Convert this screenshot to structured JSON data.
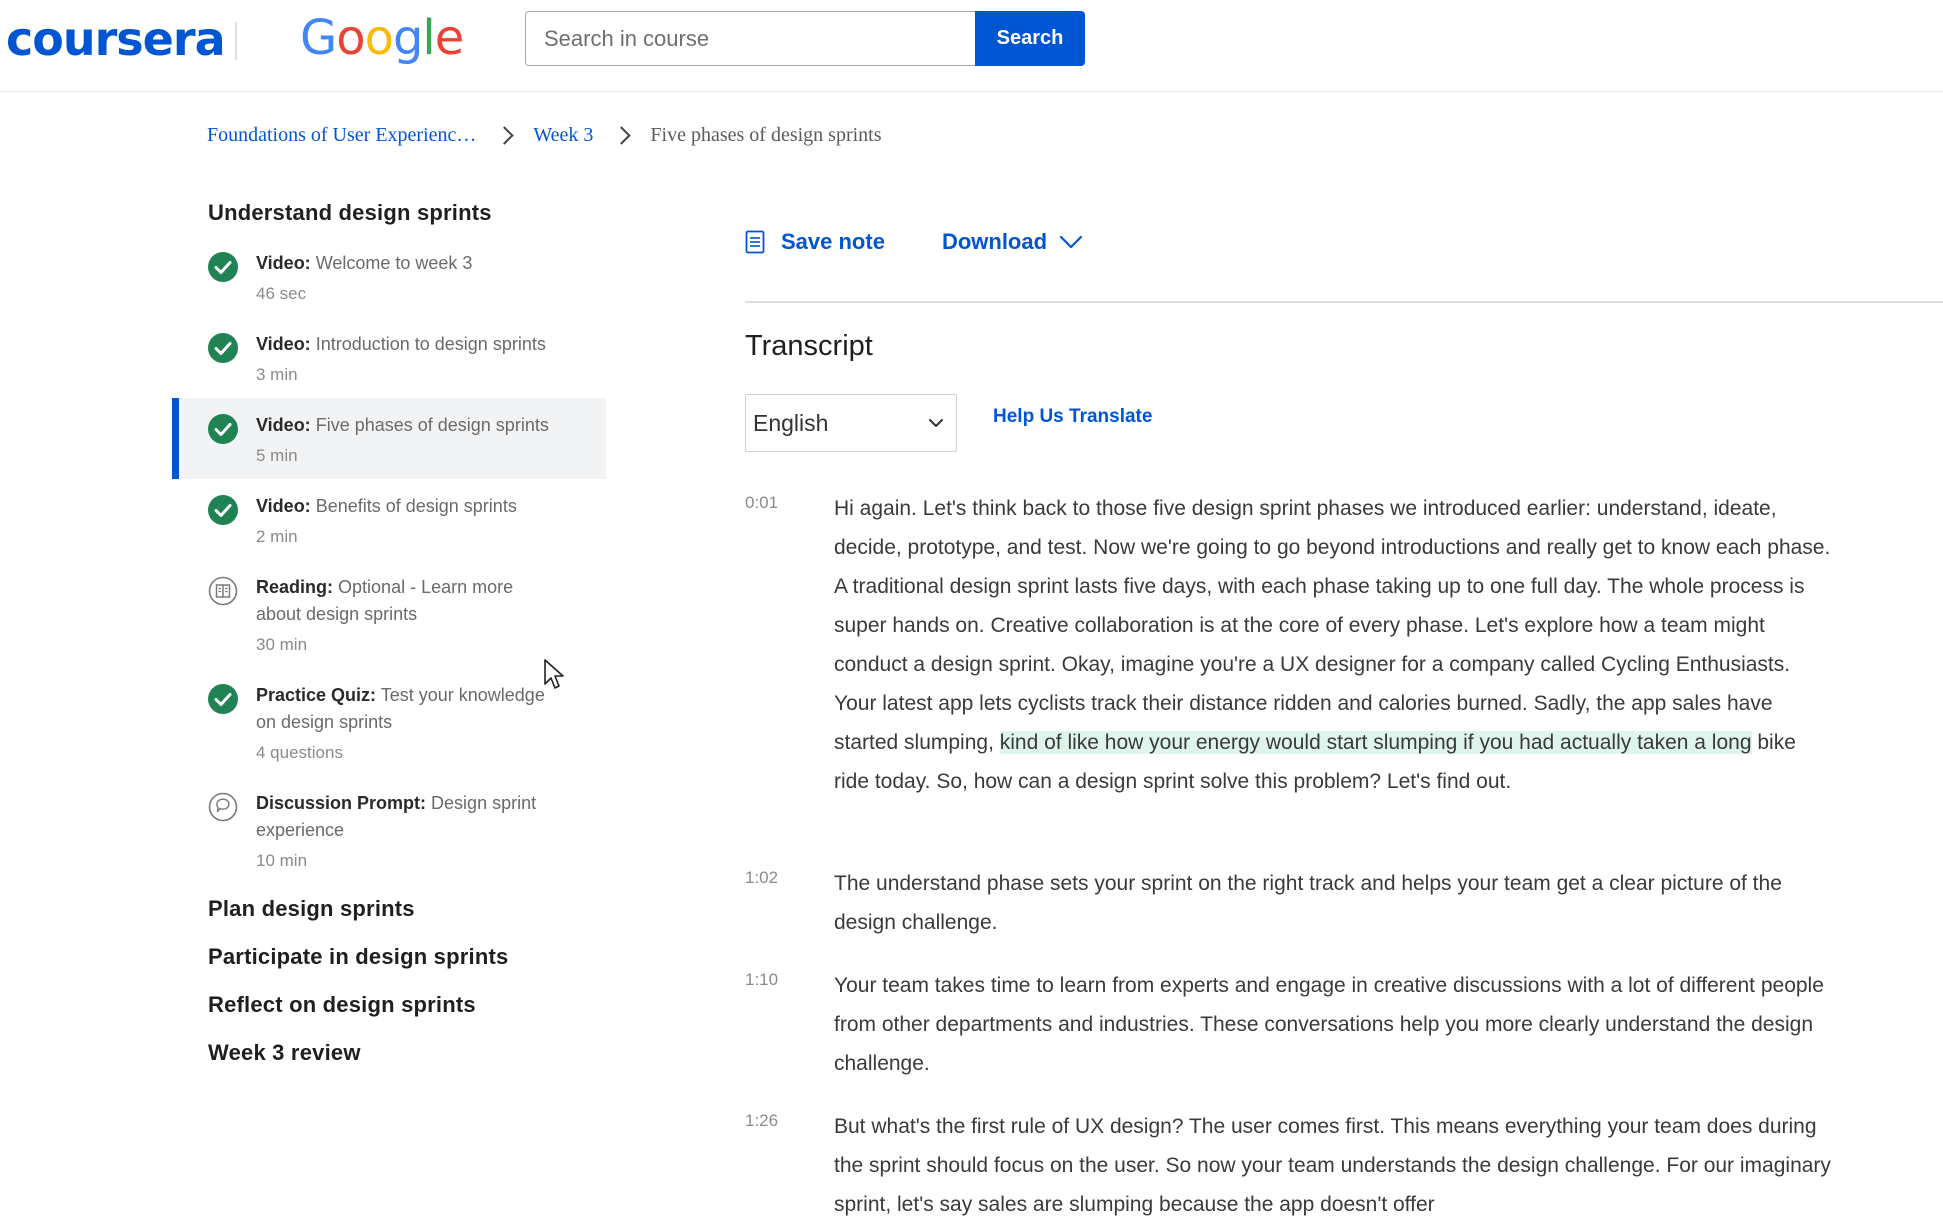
{
  "header": {
    "logo_text": "coursera",
    "partner_logo_letters": [
      {
        "ch": "G",
        "color": "#4285F4"
      },
      {
        "ch": "o",
        "color": "#EA4335"
      },
      {
        "ch": "o",
        "color": "#FBBC05"
      },
      {
        "ch": "g",
        "color": "#4285F4"
      },
      {
        "ch": "l",
        "color": "#34A853"
      },
      {
        "ch": "e",
        "color": "#EA4335"
      }
    ],
    "search_placeholder": "Search in course",
    "search_button": "Search"
  },
  "breadcrumb": {
    "course": "Foundations of User Experienc…",
    "week": "Week 3",
    "current": "Five phases of design sprints"
  },
  "sidebar": {
    "module_title": "Understand design sprints",
    "lessons": [
      {
        "type": "Video:",
        "title": "Welcome to week 3",
        "title_line2": "",
        "duration": "46 sec",
        "icon": "check-circle-icon"
      },
      {
        "type": "Video:",
        "title": "Introduction to design sprints",
        "title_line2": "",
        "duration": "3 min",
        "icon": "check-circle-icon"
      },
      {
        "type": "Video:",
        "title": "Five phases of design sprints",
        "title_line2": "",
        "duration": "5 min",
        "icon": "check-circle-icon"
      },
      {
        "type": "Video:",
        "title": "Benefits of design sprints",
        "title_line2": "",
        "duration": "2 min",
        "icon": "check-circle-icon"
      },
      {
        "type": "Reading:",
        "title": "Optional - Learn more",
        "title_line2": "about design sprints",
        "duration": "30 min",
        "icon": "book-icon"
      },
      {
        "type": "Practice Quiz:",
        "title": "Test your knowledge",
        "title_line2": "on design sprints",
        "duration": "4 questions",
        "icon": "check-circle-icon"
      },
      {
        "type": "Discussion Prompt:",
        "title": "Design sprint",
        "title_line2": "experience",
        "duration": "10 min",
        "icon": "chat-bubble-icon"
      }
    ],
    "other_modules": [
      "Plan design sprints",
      "Participate in design sprints",
      "Reflect on design sprints",
      "Week 3 review"
    ]
  },
  "toolbar": {
    "save_note": "Save note",
    "download": "Download"
  },
  "transcript": {
    "title": "Transcript",
    "language": "English",
    "help_translate": "Help Us Translate",
    "paragraphs": [
      {
        "time": "0:01",
        "before": "Hi again. Let's think back to those five design sprint phases we introduced earlier: understand, ideate, decide, prototype, and test. Now we're going to go beyond introductions and really get to know each phase. A traditional design sprint lasts five days, with each phase taking up to one full day. The whole process is super hands on. Creative collaboration is at the core of every phase. Let's explore how a team might conduct a design sprint. Okay, imagine you're a UX designer for a company called Cycling Enthusiasts. Your latest app lets cyclists track their distance ridden and calories burned. Sadly, the app sales have started slumping, ",
        "highlight": "kind of like how your energy would start slumping if you had actually taken a long",
        "after": " bike ride today. So, how can a design sprint solve this problem? Let's find out."
      },
      {
        "time": "1:02",
        "text": "The understand phase sets your sprint on the right track and helps your team get a clear picture of the design challenge."
      },
      {
        "time": "1:10",
        "text": "Your team takes time to learn from experts and engage in creative discussions with a lot of different people from other departments and industries. These conversations help you more clearly understand the design challenge."
      },
      {
        "time": "1:26",
        "text": "But what's the first rule of UX design? The user comes first. This means everything your team does during the sprint should focus on the user. So now your team understands the design challenge. For our imaginary sprint, let's say sales are slumping because the app doesn't offer"
      }
    ]
  },
  "colors": {
    "brand_blue": "#0056d2",
    "complete_green": "#1f8354",
    "highlight": "#dff4ea"
  }
}
